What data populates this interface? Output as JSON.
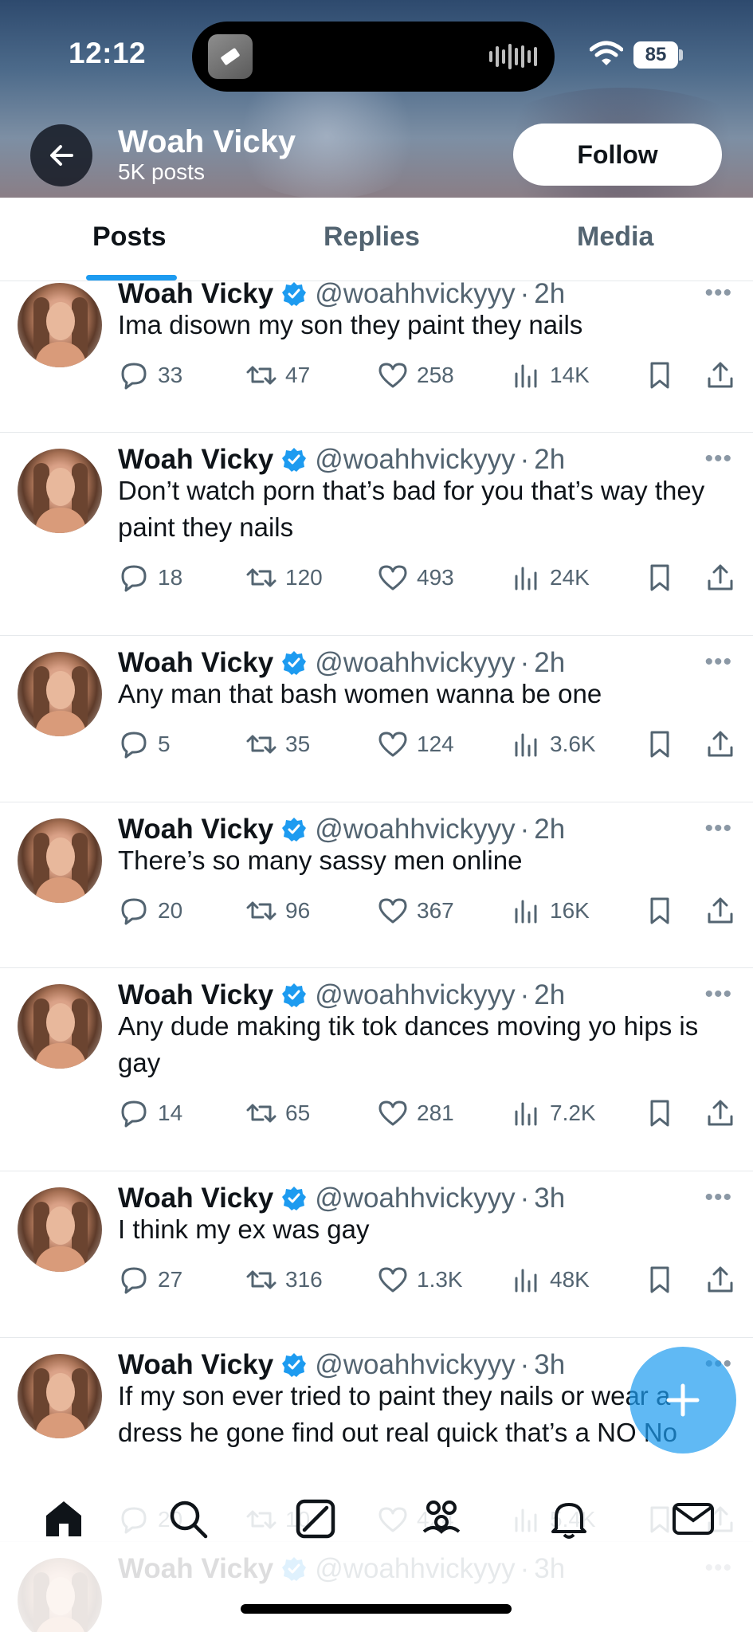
{
  "status_bar": {
    "time": "12:12",
    "battery": "85"
  },
  "header": {
    "name": "Woah Vicky",
    "posts_count": "5K posts",
    "follow_label": "Follow"
  },
  "tabs": [
    {
      "label": "Posts",
      "active": true
    },
    {
      "label": "Replies",
      "active": false
    },
    {
      "label": "Media",
      "active": false
    }
  ],
  "colors": {
    "accent": "#1d9bf0",
    "text": "#0f1419",
    "muted": "#536471"
  },
  "tweets": [
    {
      "name": "Woah Vicky",
      "handle": "@woahhvickyyy",
      "time": "2h",
      "text": "Ima disown my son they paint they nails",
      "replies": "33",
      "retweets": "47",
      "likes": "258",
      "views": "14K"
    },
    {
      "name": "Woah Vicky",
      "handle": "@woahhvickyyy",
      "time": "2h",
      "text": "Don’t watch porn that’s bad for you that’s way they paint they nails",
      "replies": "18",
      "retweets": "120",
      "likes": "493",
      "views": "24K"
    },
    {
      "name": "Woah Vicky",
      "handle": "@woahhvickyyy",
      "time": "2h",
      "text": "Any man that bash  women wanna be one",
      "replies": "5",
      "retweets": "35",
      "likes": "124",
      "views": "3.6K"
    },
    {
      "name": "Woah Vicky",
      "handle": "@woahhvickyyy",
      "time": "2h",
      "text": "There’s so many sassy men online",
      "replies": "20",
      "retweets": "96",
      "likes": "367",
      "views": "16K"
    },
    {
      "name": "Woah Vicky",
      "handle": "@woahhvickyyy",
      "time": "2h",
      "text": "Any dude making tik tok dances moving yo hips is gay",
      "replies": "14",
      "retweets": "65",
      "likes": "281",
      "views": "7.2K"
    },
    {
      "name": "Woah Vicky",
      "handle": "@woahhvickyyy",
      "time": "3h",
      "text": "I think my ex was gay",
      "replies": "27",
      "retweets": "316",
      "likes": "1.3K",
      "views": "48K"
    },
    {
      "name": "Woah Vicky",
      "handle": "@woahhvickyyy",
      "time": "3h",
      "text": "If my son ever tried to paint they nails or wear a dress he gone find out real quick that’s a NO No",
      "replies": "20",
      "retweets": "10",
      "likes": "424",
      "views": "5.4K"
    },
    {
      "name": "Woah Vicky",
      "handle": "@woahhvickyyy",
      "time": "3h",
      "text": "",
      "replies": "",
      "retweets": "",
      "likes": "",
      "views": ""
    }
  ],
  "icons": {
    "back": "arrow-left-icon",
    "verified": "verified-badge-icon",
    "more": "more-icon",
    "reply": "reply-icon",
    "retweet": "retweet-icon",
    "like": "heart-icon",
    "views": "views-icon",
    "bookmark": "bookmark-icon",
    "share": "share-icon",
    "fab": "plus-icon",
    "nav": [
      "home-icon",
      "search-icon",
      "grok-icon",
      "communities-icon",
      "notifications-icon",
      "messages-icon"
    ]
  }
}
